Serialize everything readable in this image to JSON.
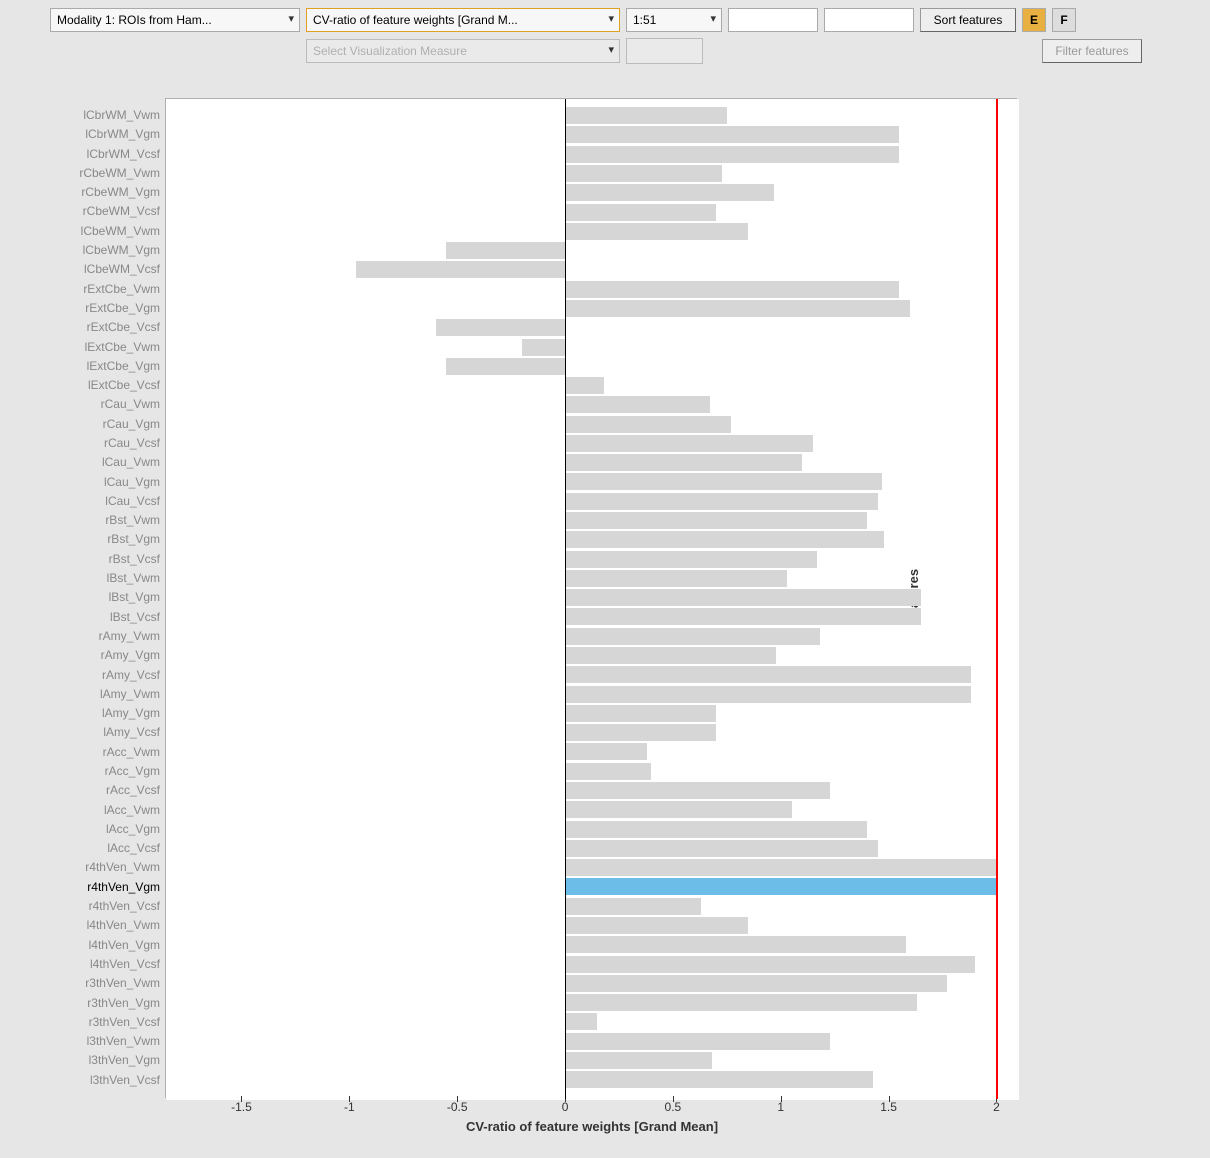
{
  "toolbar": {
    "modality": "Modality 1: ROIs from Ham...",
    "measure": "CV-ratio of feature weights [Grand M...",
    "range": "1:51",
    "input_a": "",
    "input_b": "",
    "sort_label": "Sort features",
    "e_label": "E",
    "f_label": "F",
    "viz_placeholder": "Select Visualization Measure",
    "filter_label": "Filter features"
  },
  "chart_data": {
    "type": "bar",
    "orientation": "horizontal",
    "xlabel": "CV-ratio of feature weights [Grand Mean]",
    "ylabel": "Features",
    "xlim": [
      -1.85,
      2.1
    ],
    "xticks": [
      -1.5,
      -1,
      -0.5,
      0,
      0.5,
      1,
      1.5,
      2
    ],
    "selected": "r4thVen_Vgm",
    "ref_line_x": 2.0,
    "features": [
      {
        "name": "lCbrWM_Vwm",
        "value": 0.75
      },
      {
        "name": "lCbrWM_Vgm",
        "value": 1.55
      },
      {
        "name": "lCbrWM_Vcsf",
        "value": 1.55
      },
      {
        "name": "rCbeWM_Vwm",
        "value": 0.73
      },
      {
        "name": "rCbeWM_Vgm",
        "value": 0.97
      },
      {
        "name": "rCbeWM_Vcsf",
        "value": 0.7
      },
      {
        "name": "lCbeWM_Vwm",
        "value": 0.85
      },
      {
        "name": "lCbeWM_Vgm",
        "value": -0.55
      },
      {
        "name": "lCbeWM_Vcsf",
        "value": -0.97
      },
      {
        "name": "rExtCbe_Vwm",
        "value": 1.55
      },
      {
        "name": "rExtCbe_Vgm",
        "value": 1.6
      },
      {
        "name": "rExtCbe_Vcsf",
        "value": -0.6
      },
      {
        "name": "lExtCbe_Vwm",
        "value": -0.2
      },
      {
        "name": "lExtCbe_Vgm",
        "value": -0.55
      },
      {
        "name": "lExtCbe_Vcsf",
        "value": 0.18
      },
      {
        "name": "rCau_Vwm",
        "value": 0.67
      },
      {
        "name": "rCau_Vgm",
        "value": 0.77
      },
      {
        "name": "rCau_Vcsf",
        "value": 1.15
      },
      {
        "name": "lCau_Vwm",
        "value": 1.1
      },
      {
        "name": "lCau_Vgm",
        "value": 1.47
      },
      {
        "name": "lCau_Vcsf",
        "value": 1.45
      },
      {
        "name": "rBst_Vwm",
        "value": 1.4
      },
      {
        "name": "rBst_Vgm",
        "value": 1.48
      },
      {
        "name": "rBst_Vcsf",
        "value": 1.17
      },
      {
        "name": "lBst_Vwm",
        "value": 1.03
      },
      {
        "name": "lBst_Vgm",
        "value": 1.65
      },
      {
        "name": "lBst_Vcsf",
        "value": 1.65
      },
      {
        "name": "rAmy_Vwm",
        "value": 1.18
      },
      {
        "name": "rAmy_Vgm",
        "value": 0.98
      },
      {
        "name": "rAmy_Vcsf",
        "value": 1.88
      },
      {
        "name": "lAmy_Vwm",
        "value": 1.88
      },
      {
        "name": "lAmy_Vgm",
        "value": 0.7
      },
      {
        "name": "lAmy_Vcsf",
        "value": 0.7
      },
      {
        "name": "rAcc_Vwm",
        "value": 0.38
      },
      {
        "name": "rAcc_Vgm",
        "value": 0.4
      },
      {
        "name": "rAcc_Vcsf",
        "value": 1.23
      },
      {
        "name": "lAcc_Vwm",
        "value": 1.05
      },
      {
        "name": "lAcc_Vgm",
        "value": 1.4
      },
      {
        "name": "lAcc_Vcsf",
        "value": 1.45
      },
      {
        "name": "r4thVen_Vwm",
        "value": 2.0
      },
      {
        "name": "r4thVen_Vgm",
        "value": 2.0
      },
      {
        "name": "r4thVen_Vcsf",
        "value": 0.63
      },
      {
        "name": "l4thVen_Vwm",
        "value": 0.85
      },
      {
        "name": "l4thVen_Vgm",
        "value": 1.58
      },
      {
        "name": "l4thVen_Vcsf",
        "value": 1.9
      },
      {
        "name": "r3thVen_Vwm",
        "value": 1.77
      },
      {
        "name": "r3thVen_Vgm",
        "value": 1.63
      },
      {
        "name": "r3thVen_Vcsf",
        "value": 0.15
      },
      {
        "name": "l3thVen_Vwm",
        "value": 1.23
      },
      {
        "name": "l3thVen_Vgm",
        "value": 0.68
      },
      {
        "name": "l3thVen_Vcsf",
        "value": 1.43
      }
    ]
  }
}
